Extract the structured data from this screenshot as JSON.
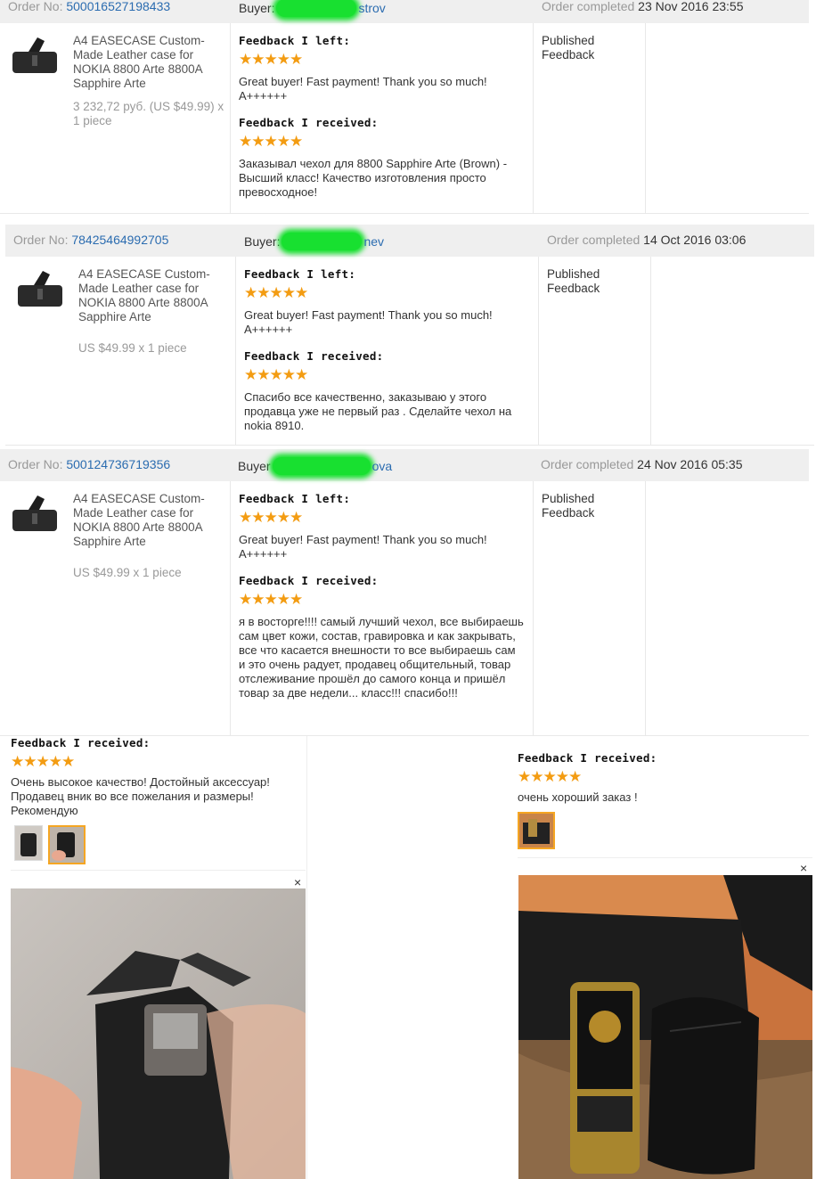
{
  "orders": [
    {
      "order_label": "Order No:",
      "order_no": "500016527198433",
      "buyer_label": "Buyer:",
      "buyer_suffix": "strov",
      "completed_label": "Order completed",
      "completed_date": "23 Nov 2016 23:55",
      "product_title": "A4 EASECASE Custom-Made Leather case for NOKIA 8800 Arte 8800A Sapphire Arte",
      "price": "3 232,72 руб. (US $49.99) x 1 piece",
      "fb_left_title": "Feedback I left:",
      "fb_left_stars": "★★★★★",
      "fb_left_text": "Great buyer! Fast payment! Thank you so much! A++++++",
      "fb_recv_title": "Feedback I received:",
      "fb_recv_stars": "★★★★★",
      "fb_recv_text": "Заказывал чехол для 8800 Sapphire Arte (Brown) - Высший класс! Качество изготовления просто превосходное!",
      "status": "Published Feedback"
    },
    {
      "order_label": "Order No:",
      "order_no": "78425464992705",
      "buyer_label": "Buyer:",
      "buyer_suffix": "nev",
      "completed_label": "Order completed",
      "completed_date": "14 Oct 2016 03:06",
      "product_title": "A4 EASECASE Custom-Made Leather case for NOKIA 8800 Arte 8800A Sapphire Arte",
      "price": "US $49.99 x 1 piece",
      "fb_left_title": "Feedback I left:",
      "fb_left_stars": "★★★★★",
      "fb_left_text": "Great buyer! Fast payment! Thank you so much! A++++++",
      "fb_recv_title": "Feedback I received:",
      "fb_recv_stars": "★★★★★",
      "fb_recv_text": "Спасибо все качественно, заказываю у этого продавца уже не первый раз . Сделайте чехол на nokia 8910.",
      "status": "Published Feedback"
    },
    {
      "order_label": "Order No:",
      "order_no": "500124736719356",
      "buyer_label": "Buyer",
      "buyer_suffix": "ova",
      "completed_label": "Order completed",
      "completed_date": "24 Nov 2016 05:35",
      "product_title": "A4 EASECASE Custom-Made Leather case for NOKIA 8800 Arte 8800A Sapphire Arte",
      "price": "US $49.99 x 1 piece",
      "fb_left_title": "Feedback I left:",
      "fb_left_stars": "★★★★★",
      "fb_left_text": "Great buyer! Fast payment! Thank you so much! A++++++",
      "fb_recv_title": "Feedback I received:",
      "fb_recv_stars": "★★★★★",
      "fb_recv_text": "я в восторге!!!! самый лучший чехол, все выбираешь сам цвет кожи, состав, гравировка и как закрывать, все что касается внешности то все выбираешь сам и это очень радует, продавец общительный, товар отслеживание прошёл до самого конца и пришёл товар за две недели... класс!!! спасибо!!!",
      "status": "Published Feedback"
    }
  ],
  "reviews": [
    {
      "title": "Feedback I received:",
      "stars": "★★★★★",
      "text": "Очень высокое качество! Достойный аксессуар! Продавец вник во все пожелания и размеры! Рекомендую",
      "close": "×"
    },
    {
      "title": "Feedback I received:",
      "stars": "★★★★★",
      "text": "очень хороший заказ !",
      "close": "×"
    }
  ],
  "colors": {
    "star": "#f39c12",
    "link": "#2b6cb0",
    "header_bg": "#efefef",
    "thumb_border": "#f5a623"
  }
}
